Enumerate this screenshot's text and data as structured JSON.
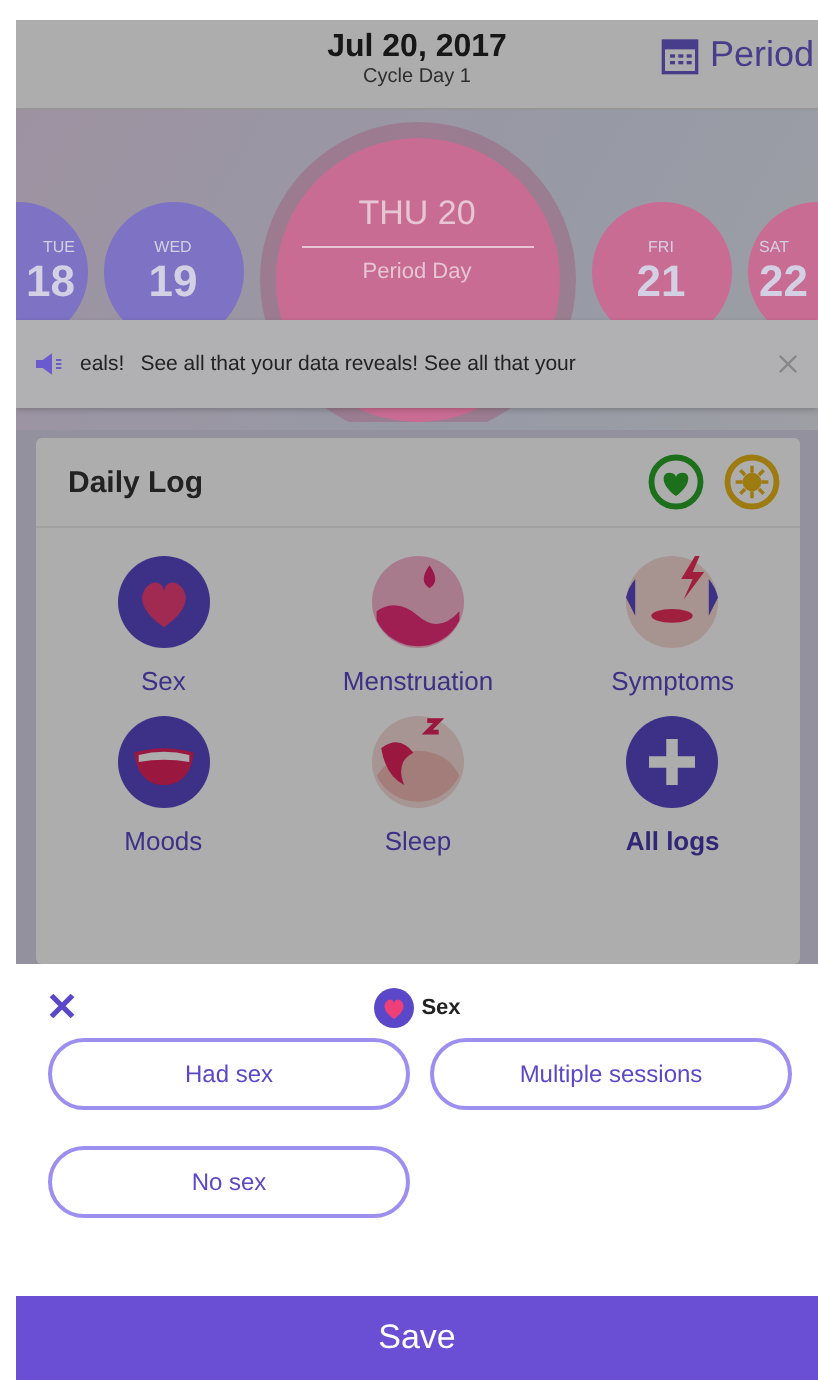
{
  "header": {
    "date": "Jul 20, 2017",
    "subtitle": "Cycle Day 1",
    "period_button": "Period"
  },
  "days": [
    {
      "weekday": "TUE",
      "day": "18",
      "color": "#7d72c4",
      "selected": false
    },
    {
      "weekday": "WED",
      "day": "19",
      "color": "#7d72c4",
      "selected": false
    },
    {
      "weekday": "THU",
      "day": "20",
      "note": "Period Day",
      "color": "#c96c93",
      "selected": true
    },
    {
      "weekday": "FRI",
      "day": "21",
      "color": "#c96c93",
      "selected": false
    },
    {
      "weekday": "SAT",
      "day": "22",
      "color": "#c96c93",
      "selected": false
    }
  ],
  "banner": {
    "text_start": "eals!",
    "text": "See all that your data reveals! See all that your"
  },
  "daily_log": {
    "title": "Daily Log",
    "items": [
      {
        "label": "Sex",
        "kind": "sex"
      },
      {
        "label": "Menstruation",
        "kind": "menstruation"
      },
      {
        "label": "Symptoms",
        "kind": "symptoms"
      },
      {
        "label": "Moods",
        "kind": "moods"
      },
      {
        "label": "Sleep",
        "kind": "sleep"
      },
      {
        "label": "All logs",
        "kind": "all"
      }
    ]
  },
  "sheet": {
    "title": "Sex",
    "options": [
      {
        "label": "Had sex",
        "selected": false
      },
      {
        "label": "Multiple sessions",
        "selected": false
      },
      {
        "label": "No sex",
        "selected": false
      }
    ],
    "save": "Save"
  }
}
